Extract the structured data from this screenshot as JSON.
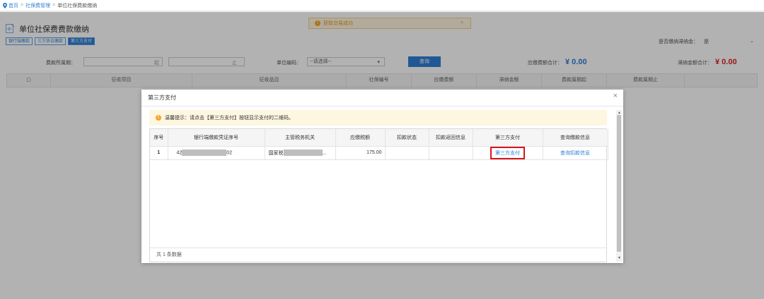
{
  "breadcrumb": {
    "home": "首页",
    "section": "社保费管理",
    "current": "单位社保费款缴纳"
  },
  "background": {
    "title": "单位社保费费款缴纳",
    "buttons": [
      "银行端缴款",
      "三方协议缴款",
      "第三方支付"
    ],
    "toast": "获取交易成功",
    "option_label": "是否缴纳滞纳金：",
    "option_value": "是",
    "filter": {
      "period_label": "费款所属期：",
      "date_from_suffix": "起",
      "date_to_suffix": "止",
      "unit_label": "单位编码：",
      "unit_placeholder": "--请选择--",
      "query_label": "查询",
      "payable_label": "应缴费额合计：",
      "payable_value": "¥ 0.00",
      "late_label": "滞纳金额合计：",
      "late_value": "¥ 0.00"
    },
    "columns": [
      "",
      "征收项目",
      "征收品目",
      "社保编号",
      "应缴费额",
      "滞纳金额",
      "费款属期起",
      "费款属期止"
    ]
  },
  "modal": {
    "title": "第三方支付",
    "tip": "温馨提示：请点击【第三方支付】按钮显示支付的二维码。",
    "columns": [
      "序号",
      "银行端缴款凭证序号",
      "主管税务机关",
      "应缴税额",
      "扣款状态",
      "扣款返回信息",
      "第三方支付",
      "查询缴款信息"
    ],
    "rows": [
      {
        "index": "1",
        "voucher_prefix": "42",
        "voucher_suffix": "02",
        "tax_office_prefix": "国家税",
        "tax_office_suffix": "...",
        "amount": "175.00",
        "status": "",
        "return_info": "",
        "pay_label": "第三方支付",
        "query_label": "查询扣款信息"
      }
    ],
    "footer": "共 1 条数据"
  },
  "colors": {
    "accent": "#2f7fd6",
    "highlight": "#d8141b",
    "tip_bg": "#fdf6e0"
  }
}
